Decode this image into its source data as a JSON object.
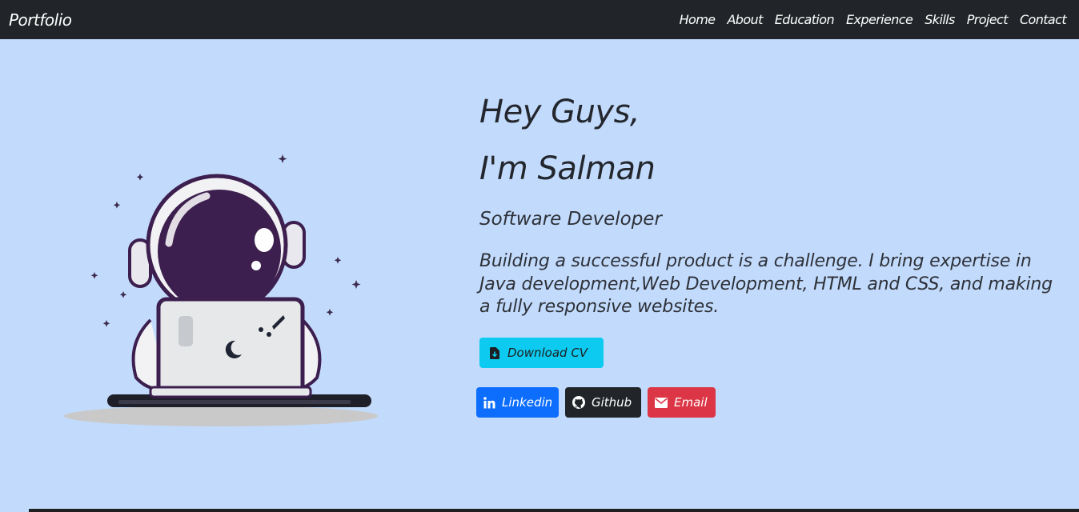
{
  "navbar": {
    "brand": "Portfolio",
    "links": [
      "Home",
      "About",
      "Education",
      "Experience",
      "Skills",
      "Project",
      "Contact"
    ]
  },
  "hero": {
    "greeting": "Hey Guys,",
    "name": "I'm Salman",
    "role": "Software Developer",
    "bio": "Building a successful product is a challenge. I bring expertise in Java development,Web Development, HTML and CSS, and making a fully responsive websites.",
    "download_label": "Download CV",
    "social": {
      "linkedin": "Linkedin",
      "github": "Github",
      "email": "Email"
    }
  },
  "colors": {
    "navbar_bg": "#212529",
    "page_bg": "#c2dbfd",
    "cv_button": "#0dcaf0",
    "linkedin": "#0d6efd",
    "github": "#212529",
    "email": "#dc3545"
  },
  "icons": {
    "cv": "file-download-icon",
    "linkedin": "linkedin-icon",
    "github": "github-icon",
    "email": "envelope-icon"
  }
}
